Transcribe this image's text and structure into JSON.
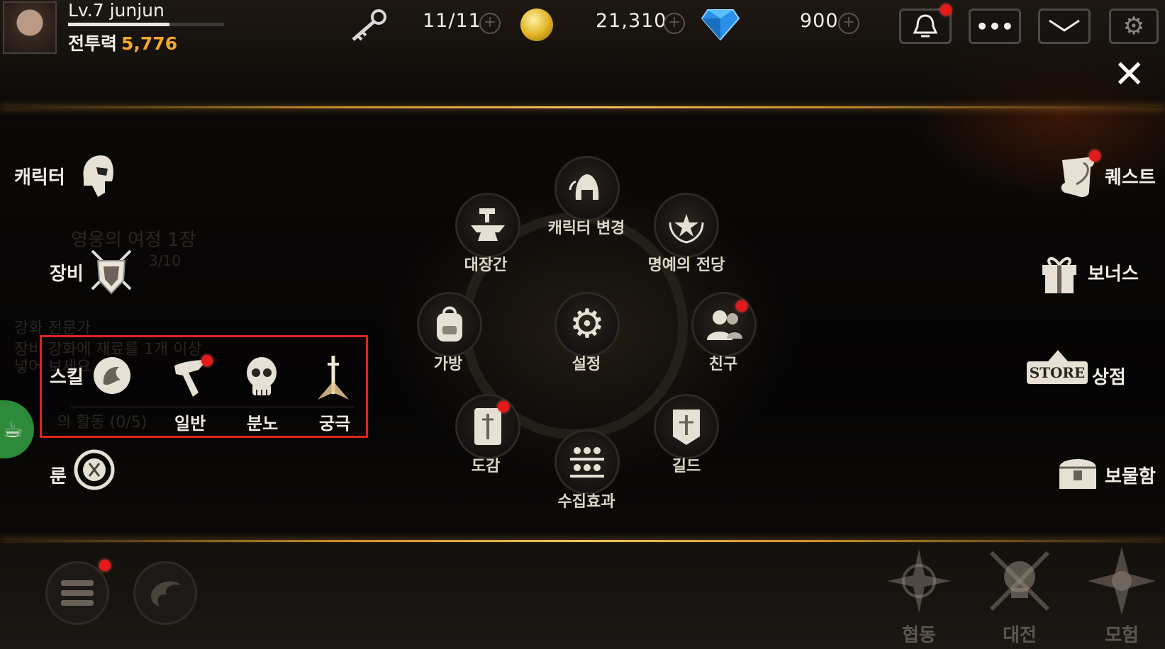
{
  "profile": {
    "level_name": "Lv.7 junjun",
    "power_label": "전투력",
    "power_value": "5,776",
    "xp_progress": 0.65
  },
  "resources": {
    "keys": "11/11",
    "gold": "21,310",
    "gems": "900"
  },
  "header_icons": [
    "key-icon",
    "gold-coin-icon",
    "diamond-icon",
    "bell-icon",
    "chat-icon",
    "mail-icon",
    "gear-icon",
    "close-icon"
  ],
  "left_menu": {
    "character": "캐릭터",
    "equipment": "장비",
    "skill": "스킬",
    "skill_types": [
      {
        "label": "일반",
        "badge": true
      },
      {
        "label": "분노",
        "badge": false
      },
      {
        "label": "궁극",
        "badge": false
      }
    ],
    "rune": "룬"
  },
  "faded_text": {
    "quest_title": "영웅의 여정 1장",
    "quest_progress": "3/10",
    "hint_title": "강화 전문가",
    "hint_line1": "장비 강화에 재료를 1개 이상",
    "hint_line2": "넣어 보세요",
    "activity": "의 활동 (0/5)"
  },
  "center_menu": {
    "char_change": "캐릭터 변경",
    "blacksmith": "대장간",
    "hall_of_fame": "명예의 전당",
    "bag": "가방",
    "settings": "설정",
    "friends": "친구",
    "codex": "도감",
    "guild": "길드",
    "collection": "수집효과"
  },
  "right_menu": {
    "quest": "퀘스트",
    "bonus": "보너스",
    "shop": "상점",
    "shop_sign": "STORE",
    "treasure": "보물함"
  },
  "bottom_modes": {
    "coop": "협동",
    "battle": "대전",
    "adventure": "모험"
  },
  "colors": {
    "accent_gold": "#f4a82a",
    "highlight_red": "#e0241c",
    "badge_red": "#e21a1a"
  }
}
